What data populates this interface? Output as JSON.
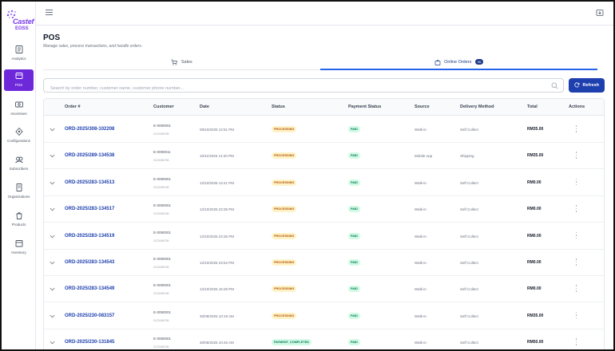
{
  "app": {
    "logo_line1": "Castef",
    "logo_line2": "EOSS"
  },
  "sidebar": {
    "items": [
      {
        "label": "Analytics",
        "icon": "chart-icon",
        "active": false
      },
      {
        "label": "POS",
        "icon": "pos-icon",
        "active": true
      },
      {
        "label": "Incentives",
        "icon": "incentive-icon",
        "active": false
      },
      {
        "label": "Configurations",
        "icon": "config-icon",
        "active": false
      },
      {
        "label": "Subscribers",
        "icon": "subscribers-icon",
        "active": false
      },
      {
        "label": "Organizations",
        "icon": "organizations-icon",
        "active": false
      },
      {
        "label": "Products",
        "icon": "products-icon",
        "active": false
      },
      {
        "label": "Inventory",
        "icon": "inventory-icon",
        "active": false
      }
    ]
  },
  "page": {
    "title": "POS",
    "subtitle": "Manage sales, process transactions, and handle orders."
  },
  "tabs": [
    {
      "label": "Sales",
      "icon": "cart-icon"
    },
    {
      "label": "Online Orders",
      "icon": "bag-icon",
      "badge": "96"
    }
  ],
  "search": {
    "placeholder": "Search by order number, customer name, customer phone number..."
  },
  "refresh_label": "Refresh",
  "table": {
    "headers": [
      "Order #",
      "Customer",
      "Date",
      "Status",
      "Payment Status",
      "Source",
      "Delivery Method",
      "Total",
      "Actions"
    ],
    "rows": [
      {
        "order": "ORD-2025/308-102208",
        "customer": "E-0090001",
        "customer_sub": "0123456789",
        "date": "08/10/2025 12:51 PM",
        "status": "PROCESSING",
        "payment": "PAID",
        "source": "Walk-in",
        "delivery": "Self Collect",
        "total": "RM35.00"
      },
      {
        "order": "ORD-2025/289-134538",
        "customer": "E-0090011",
        "customer_sub": "0123456789",
        "date": "10/11/2025 14:20 PM",
        "status": "PROCESSING",
        "payment": "PAID",
        "source": "Mobile App",
        "delivery": "Shipping",
        "total": "RM35.00"
      },
      {
        "order": "ORD-2025/283-134513",
        "customer": "E-0090001",
        "customer_sub": "0123456789",
        "date": "12/10/2025 13:41 PM",
        "status": "PROCESSING",
        "payment": "PAID",
        "source": "Walk-in",
        "delivery": "Self Collect",
        "total": "RM0.00"
      },
      {
        "order": "ORD-2025/283-134517",
        "customer": "E-0090001",
        "customer_sub": "0123456789",
        "date": "12/10/2025 23:35 PM",
        "status": "PROCESSING",
        "payment": "PAID",
        "source": "Walk-in",
        "delivery": "Self Collect",
        "total": "RM0.00"
      },
      {
        "order": "ORD-2025/283-134519",
        "customer": "E-0090001",
        "customer_sub": "0123456789",
        "date": "12/10/2025 23:35 PM",
        "status": "PROCESSING",
        "payment": "PAID",
        "source": "Walk-in",
        "delivery": "Self Collect",
        "total": "RM0.00"
      },
      {
        "order": "ORD-2025/283-134543",
        "customer": "E-0090001",
        "customer_sub": "0123456789",
        "date": "12/10/2025 23:52 PM",
        "status": "PROCESSING",
        "payment": "PAID",
        "source": "Walk-in",
        "delivery": "Self Collect",
        "total": "RM0.00"
      },
      {
        "order": "ORD-2025/283-134549",
        "customer": "E-0090001",
        "customer_sub": "0123456789",
        "date": "12/10/2025 16:28 PM",
        "status": "PROCESSING",
        "payment": "PAID",
        "source": "Walk-in",
        "delivery": "Self Collect",
        "total": "RM0.00"
      },
      {
        "order": "ORD-2025/230-083157",
        "customer": "E-0090001",
        "customer_sub": "0123456789",
        "date": "30/08/2025 10:19 AM",
        "status": "PROCESSING",
        "payment": "PAID",
        "source": "Walk-in",
        "delivery": "Self Collect",
        "total": "RM35.00"
      },
      {
        "order": "ORD-2025/230-131845",
        "customer": "E-0090001",
        "customer_sub": "0123456789",
        "date": "30/08/2025 10:45 AM",
        "status": "PAYMENT_COMPLETED",
        "payment": "PAID",
        "source": "Walk-in",
        "delivery": "Self Collect",
        "total": "RM50.00"
      }
    ]
  },
  "colors": {
    "accent": "#6d28d9",
    "primary": "#1e40af",
    "processing_bg": "#fef3c7",
    "paid_bg": "#d1fae5"
  }
}
